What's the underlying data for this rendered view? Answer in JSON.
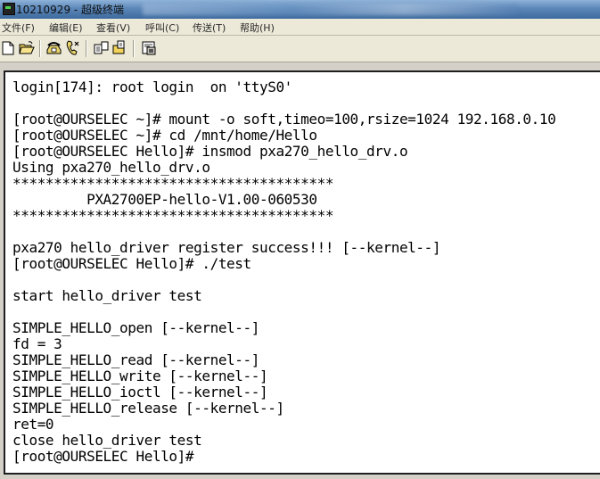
{
  "window": {
    "title": "10210929 - 超级终端"
  },
  "menu": [
    {
      "label": "文件(F)"
    },
    {
      "label": "编辑(E)"
    },
    {
      "label": "查看(V)"
    },
    {
      "label": "呼叫(C)"
    },
    {
      "label": "传送(T)"
    },
    {
      "label": "帮助(H)"
    }
  ],
  "toolbar": {
    "buttons": [
      {
        "icon": "new-document-icon"
      },
      {
        "icon": "open-folder-icon"
      },
      {
        "icon": "call-phone-icon"
      },
      {
        "icon": "disconnect-phone-icon"
      },
      {
        "icon": "send-file-icon"
      },
      {
        "icon": "receive-file-icon"
      },
      {
        "icon": "properties-icon"
      }
    ]
  },
  "terminal": {
    "lines": [
      "login[174]: root login  on 'ttyS0'",
      "",
      "[root@OURSELEC ~]# mount -o soft,timeo=100,rsize=1024 192.168.0.10",
      "[root@OURSELEC ~]# cd /mnt/home/Hello",
      "[root@OURSELEC Hello]# insmod pxa270_hello_drv.o",
      "Using pxa270_hello_drv.o",
      "***************************************",
      "         PXA2700EP-hello-V1.00-060530",
      "***************************************",
      "",
      "pxa270 hello_driver register success!!! [--kernel--]",
      "[root@OURSELEC Hello]# ./test",
      "",
      "start hello_driver test",
      "",
      "SIMPLE_HELLO_open [--kernel--]",
      "fd = 3",
      "SIMPLE_HELLO_read [--kernel--]",
      "SIMPLE_HELLO_write [--kernel--]",
      "SIMPLE_HELLO_ioctl [--kernel--]",
      "SIMPLE_HELLO_release [--kernel--]",
      "ret=0",
      "close hello_driver test",
      "[root@OURSELEC Hello]#"
    ]
  }
}
